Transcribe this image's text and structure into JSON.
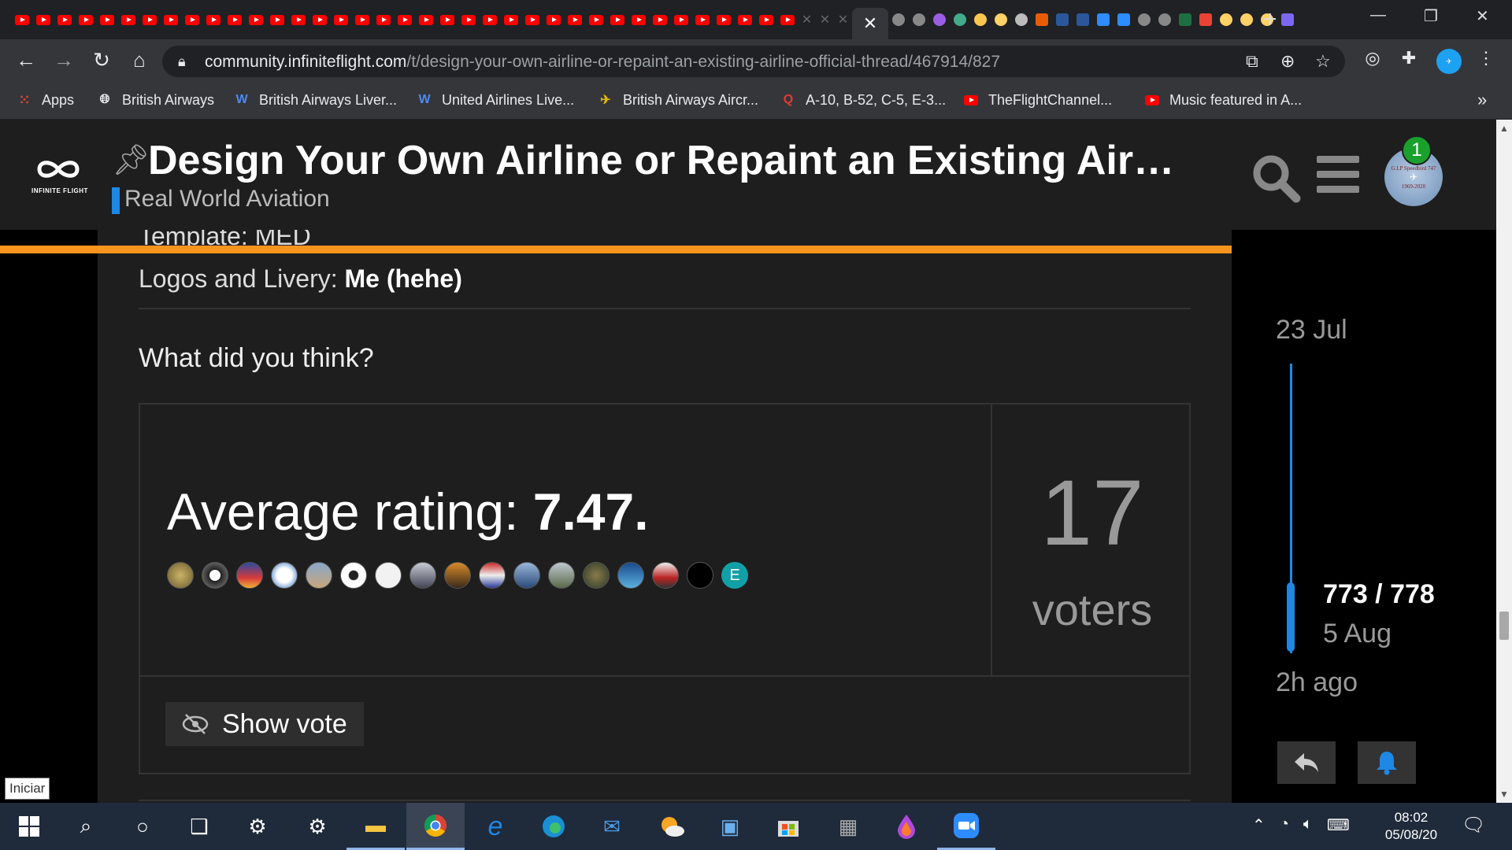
{
  "browser": {
    "tab_count_label": "",
    "url_host": "community.infiniteflight.com",
    "url_path": "/t/design-your-own-airline-or-repaint-an-existing-airline-official-thread/467914/827",
    "bookmarks": [
      {
        "label": "Apps",
        "icon": "apps-grid-icon"
      },
      {
        "label": "British Airways",
        "icon": "globe-icon"
      },
      {
        "label": "British Airways Liver...",
        "icon": "wiki-w-icon"
      },
      {
        "label": "United Airlines Live...",
        "icon": "wiki-w-icon"
      },
      {
        "label": "British Airways Aircr...",
        "icon": "aircraft-icon"
      },
      {
        "label": "A-10, B-52, C-5, E-3...",
        "icon": "search-q-icon"
      },
      {
        "label": "TheFlightChannel...",
        "icon": "youtube-icon"
      },
      {
        "label": "Music featured in A...",
        "icon": "youtube-icon"
      }
    ],
    "bookmarks_overflow": "»"
  },
  "header": {
    "logo_text": "INFINITE FLIGHT",
    "title": "Design Your Own Airline or Repaint an Existing Air…",
    "category": "Real World Aviation",
    "notifications": "1",
    "avatar_text_top": "G.LP Speedbird 747",
    "avatar_text_bottom": "1969-2020"
  },
  "post": {
    "cut_line": "Template: MED",
    "livery_label": "Logos and Livery: ",
    "livery_value": "Me (hehe)",
    "question": "What did you think?"
  },
  "poll": {
    "avg_label": "Average rating: ",
    "avg_value": "7.47",
    "avg_suffix": ".",
    "voter_count": "17",
    "voter_label": "voters",
    "show_vote_label": "Show vote",
    "avatar_letter": "E"
  },
  "timeline": {
    "start_date": "23 Jul",
    "position": "773 / 778",
    "position_date": "5 Aug",
    "end_label": "2h ago"
  },
  "tooltip": "Iniciar",
  "taskbar": {
    "time": "08:02",
    "date": "05/08/20"
  },
  "colors": {
    "accent_blue": "#1e88e5",
    "progress_orange": "#f7941d",
    "notif_green": "#1aa12d",
    "avatar_teal": "#12a0a8"
  }
}
